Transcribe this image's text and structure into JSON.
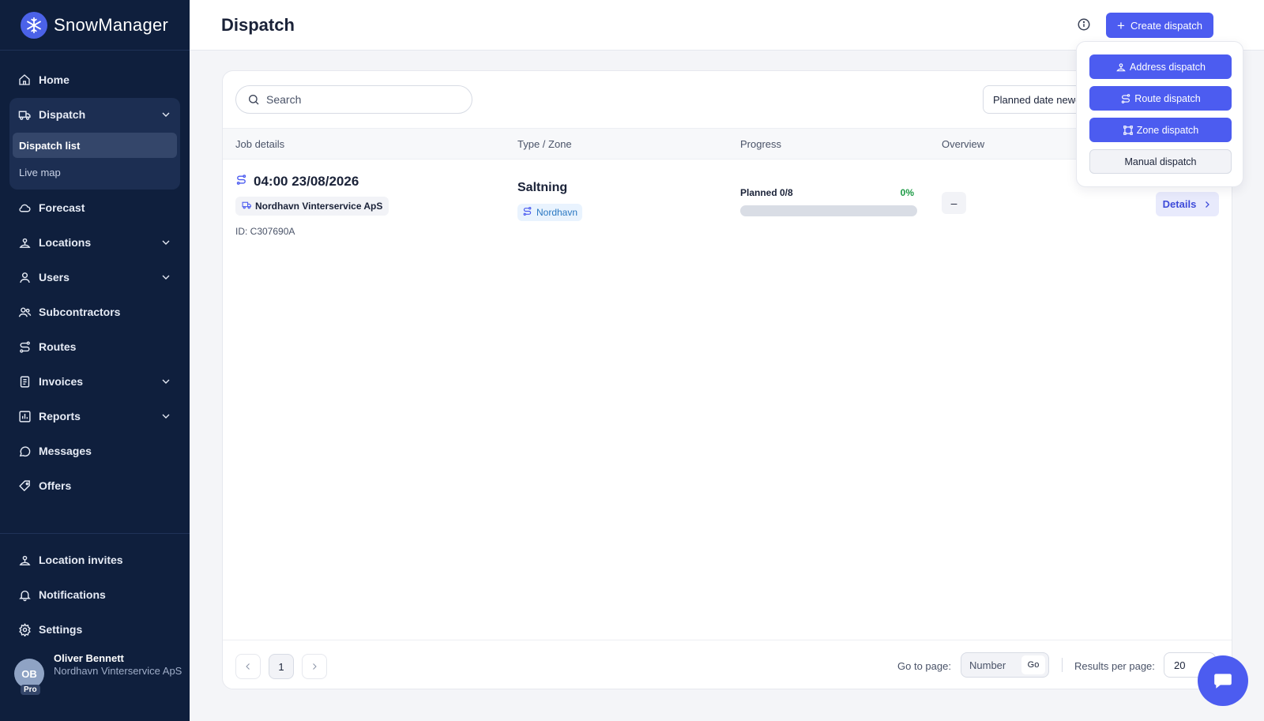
{
  "app": {
    "name": "SnowManager"
  },
  "sidebar": {
    "items": [
      {
        "label": "Home",
        "icon": "home-icon"
      },
      {
        "label": "Dispatch",
        "icon": "truck-icon",
        "expanded": true,
        "children": [
          {
            "label": "Dispatch list",
            "active": true
          },
          {
            "label": "Live map"
          }
        ]
      },
      {
        "label": "Forecast",
        "icon": "cloud-icon"
      },
      {
        "label": "Locations",
        "icon": "location-pin-icon",
        "has_children": true
      },
      {
        "label": "Users",
        "icon": "user-icon",
        "has_children": true
      },
      {
        "label": "Subcontractors",
        "icon": "users-icon"
      },
      {
        "label": "Routes",
        "icon": "route-icon"
      },
      {
        "label": "Invoices",
        "icon": "invoice-icon",
        "has_children": true
      },
      {
        "label": "Reports",
        "icon": "chart-icon",
        "has_children": true
      },
      {
        "label": "Messages",
        "icon": "message-icon"
      },
      {
        "label": "Offers",
        "icon": "tag-icon"
      }
    ],
    "bottom_items": [
      {
        "label": "Location invites",
        "icon": "location-pin-icon"
      },
      {
        "label": "Notifications",
        "icon": "bell-icon"
      },
      {
        "label": "Settings",
        "icon": "gear-icon"
      }
    ],
    "user": {
      "initials": "OB",
      "badge": "Pro",
      "name": "Oliver Bennett",
      "org": "Nordhavn Vinterservice ApS"
    }
  },
  "header": {
    "title": "Dispatch",
    "create_button": "Create dispatch"
  },
  "create_menu": {
    "items": [
      {
        "label": "Address dispatch",
        "style": "primary",
        "icon": "location-pin-icon"
      },
      {
        "label": "Route dispatch",
        "style": "primary",
        "icon": "route-icon"
      },
      {
        "label": "Zone dispatch",
        "style": "primary",
        "icon": "zone-icon"
      },
      {
        "label": "Manual dispatch",
        "style": "secondary",
        "icon": ""
      }
    ]
  },
  "toolbar": {
    "search_placeholder": "Search",
    "sort_value": "Planned date newe"
  },
  "table": {
    "columns": [
      "Job details",
      "Type / Zone",
      "Progress",
      "Overview"
    ],
    "rows": [
      {
        "time": "04:00 23/08/2026",
        "company": "Nordhavn Vinterservice ApS",
        "id": "ID: C307690A",
        "type": "Saltning",
        "zone": "Nordhavn",
        "progress_label": "Planned 0/8",
        "progress_pct": "0%",
        "progress_value": 0,
        "overview": "–",
        "action": "Details"
      }
    ]
  },
  "pagination": {
    "current_page": "1",
    "goto_label": "Go to page:",
    "goto_placeholder": "Number",
    "go_button": "Go",
    "rpp_label": "Results per page:",
    "rpp_value": "20"
  },
  "colors": {
    "sidebar_bg": "#0f1f3d",
    "accent": "#4c5cf0",
    "success": "#1e9b46"
  }
}
